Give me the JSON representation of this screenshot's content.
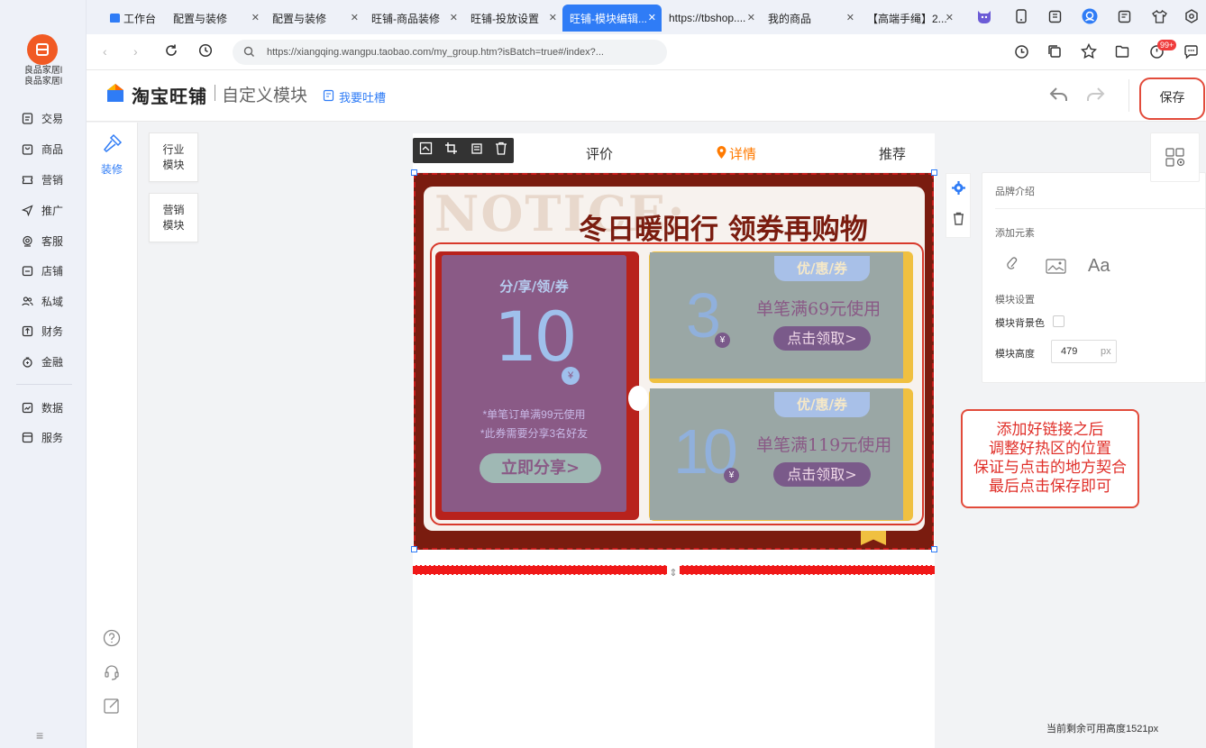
{
  "app": {
    "store_name_line1": "良品家居l",
    "store_name_line2": "良品家居l"
  },
  "nav": {
    "items": [
      {
        "label": "交易",
        "icon": "receipt-icon"
      },
      {
        "label": "商品",
        "icon": "bag-icon"
      },
      {
        "label": "营销",
        "icon": "ticket-icon"
      },
      {
        "label": "推广",
        "icon": "send-icon"
      },
      {
        "label": "客服",
        "icon": "headset-icon"
      },
      {
        "label": "店铺",
        "icon": "store-icon"
      },
      {
        "label": "私域",
        "icon": "users-icon"
      },
      {
        "label": "财务",
        "icon": "finance-icon"
      },
      {
        "label": "金融",
        "icon": "money-bag-icon"
      },
      {
        "label": "数据",
        "icon": "chart-icon"
      },
      {
        "label": "服务",
        "icon": "service-icon"
      }
    ]
  },
  "tabs": [
    {
      "label": "工作台"
    },
    {
      "label": "配置与装修"
    },
    {
      "label": "配置与装修"
    },
    {
      "label": "旺铺-商品装修"
    },
    {
      "label": "旺铺-投放设置"
    },
    {
      "label": "旺铺-模块编辑..."
    },
    {
      "label": "https://tbshop...."
    },
    {
      "label": "我的商品"
    },
    {
      "label": "【高端手绳】2..."
    }
  ],
  "addressbar": {
    "url": "https://xiangqing.wangpu.taobao.com/my_group.htm?isBatch=true#/index?...",
    "badge": "99+"
  },
  "header": {
    "brand": "淘宝旺铺",
    "subtitle": "自定义模块",
    "feedback": "我要吐槽",
    "save": "保存"
  },
  "tool": {
    "label": "装修"
  },
  "modules": {
    "industry": "行业模块",
    "marketing": "营销模块"
  },
  "preview_tabs": {
    "review": "评价",
    "detail": "详情",
    "recommend": "推荐"
  },
  "banner": {
    "watermark": "NOTICE:",
    "headline": "冬日暖阳行 领券再购物",
    "share": {
      "title": "分/享/领/券",
      "amount": "10",
      "currency": "¥",
      "note1": "*单笔订单满99元使用",
      "note2": "*此券需要分享3名好友",
      "button": "立即分享>"
    },
    "coupon1": {
      "tag": "优/惠/券",
      "amount": "3",
      "currency": "¥",
      "condition": "单笔满69元使用",
      "button": "点击领取>"
    },
    "coupon2": {
      "tag": "优/惠/券",
      "amount": "10",
      "currency": "¥",
      "condition": "单笔满119元使用",
      "button": "点击领取>"
    }
  },
  "props": {
    "section_title": "品牌介绍",
    "add_element": "添加元素",
    "element_text": "Aa",
    "module_settings": "模块设置",
    "bg_color_label": "模块背景色",
    "height_label": "模块高度",
    "height_value": "479",
    "height_unit": "px"
  },
  "callout": {
    "line1": "添加好链接之后",
    "line2": "调整好热区的位置",
    "line3": "保证与点击的地方契合",
    "line4": "最后点击保存即可"
  },
  "footer": {
    "remaining": "当前剩余可用高度1521px"
  }
}
